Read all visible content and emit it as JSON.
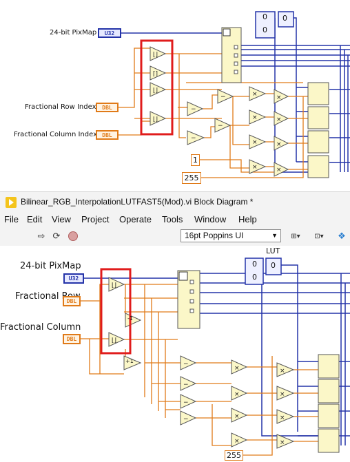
{
  "top_diagram": {
    "label_pixmap": "24-bit PixMap",
    "label_row": "Fractional Row Index",
    "label_col": "Fractional Column Index",
    "u32_tag": "U32",
    "dbl_tag": "DBL",
    "const_one": "1",
    "const_255": "255",
    "array_vals": [
      "0",
      "0"
    ],
    "array_elem": "0"
  },
  "window": {
    "title": "Bilinear_RGB_InterpolationLUTFAST5(Mod).vi Block Diagram *"
  },
  "menu": {
    "items": [
      "File",
      "Edit",
      "View",
      "Project",
      "Operate",
      "Tools",
      "Window",
      "Help"
    ]
  },
  "toolbar": {
    "font_select": "16pt Poppins UI"
  },
  "bottom_diagram": {
    "label_pixmap": "24-bit PixMap",
    "label_row": "Fractional Row",
    "label_col": "Fractional Column",
    "label_lut": "LUT",
    "u32_tag": "U32",
    "dbl_tag": "DBL",
    "const_255": "255",
    "array_vals": [
      "0",
      "0"
    ],
    "array_elem": "0",
    "decrement_label": "-1",
    "increment_label": "+1"
  },
  "colors": {
    "orange_wire": "#e07a18",
    "blue_wire": "#2433a8",
    "highlight": "#e01c1c",
    "node_fill": "#fbf7c8"
  }
}
